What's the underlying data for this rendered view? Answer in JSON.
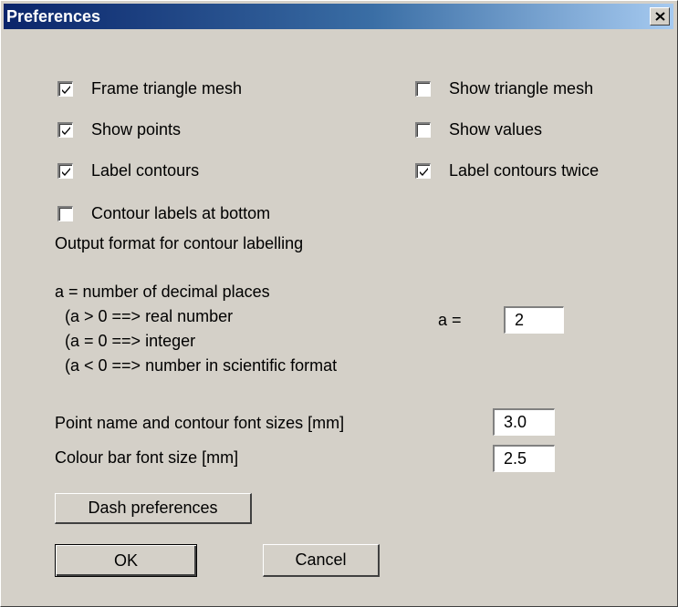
{
  "window": {
    "title": "Preferences"
  },
  "checkboxes": [
    {
      "label": "Frame triangle mesh",
      "checked": true
    },
    {
      "label": "Show triangle mesh",
      "checked": false
    },
    {
      "label": "Show points",
      "checked": true
    },
    {
      "label": "Show values",
      "checked": false
    },
    {
      "label": "Label contours",
      "checked": true
    },
    {
      "label": "Label contours twice",
      "checked": true
    },
    {
      "label": "Contour labels at bottom",
      "checked": false
    }
  ],
  "output_format": {
    "heading": "Output format for contour labelling",
    "line1": "a = number of decimal places",
    "line2": "(a > 0 ==> real number",
    "line3": "(a = 0 ==> integer",
    "line4": "(a < 0 ==> number in scientific format",
    "a_label": "a =",
    "a_value": "2"
  },
  "font_sizes": {
    "point_label": "Point name and contour font sizes [mm]",
    "point_value": "3.0",
    "colour_label": "Colour bar font size [mm]",
    "colour_value": "2.5"
  },
  "buttons": {
    "dash": "Dash preferences",
    "ok": "OK",
    "cancel": "Cancel"
  }
}
